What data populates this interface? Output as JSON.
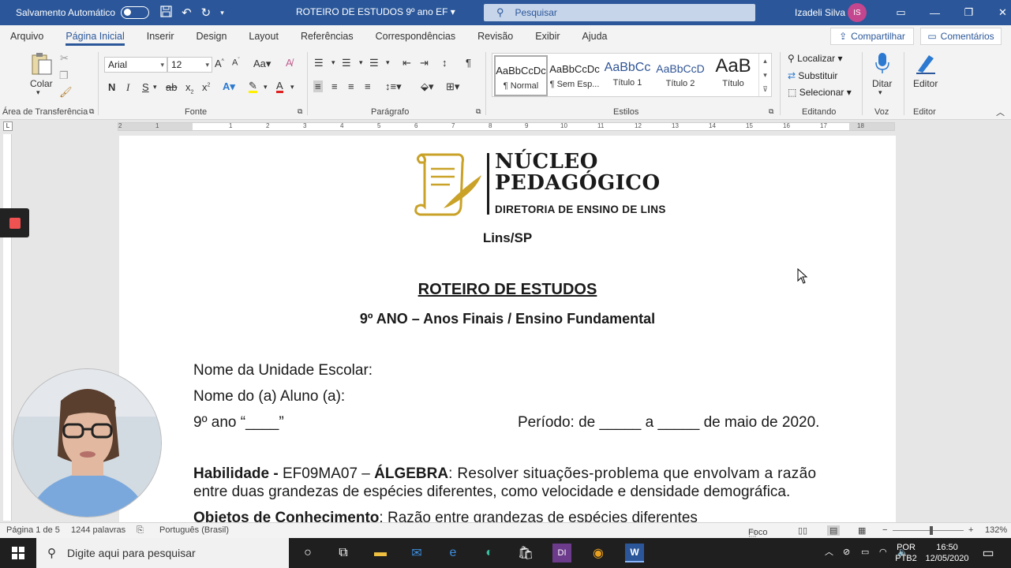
{
  "titlebar": {
    "autosave_label": "Salvamento Automático",
    "doc_title": "ROTEIRO DE ESTUDOS 9º ano EF",
    "search_placeholder": "Pesquisar",
    "user_name": "Izadeli Silva",
    "user_initials": "IS"
  },
  "tabs": [
    "Arquivo",
    "Página Inicial",
    "Inserir",
    "Design",
    "Layout",
    "Referências",
    "Correspondências",
    "Revisão",
    "Exibir",
    "Ajuda"
  ],
  "active_tab": "Página Inicial",
  "share_label": "Compartilhar",
  "comments_label": "Comentários",
  "ribbon": {
    "paste_label": "Colar",
    "font_name": "Arial",
    "font_size": "12",
    "styles": [
      {
        "preview": "AaBbCcDc",
        "name": "¶ Normal"
      },
      {
        "preview": "AaBbCcDc",
        "name": "¶ Sem Esp..."
      },
      {
        "preview": "AaBbCc",
        "name": "Título 1"
      },
      {
        "preview": "AaBbCcD",
        "name": "Título 2"
      },
      {
        "preview": "AaB",
        "name": "Título"
      }
    ],
    "find_label": "Localizar",
    "replace_label": "Substituir",
    "select_label": "Selecionar",
    "dictate_label": "Ditar",
    "editor_label": "Editor",
    "groups": [
      "Área de Transferência",
      "Fonte",
      "Parágrafo",
      "Estilos",
      "Editando",
      "Voz",
      "Editor"
    ]
  },
  "document": {
    "logo_line1": "NÚCLEO",
    "logo_line2": "PEDAGÓGICO",
    "logo_line3": "DIRETORIA DE ENSINO DE LINS",
    "city": "Lins/SP",
    "title": "ROTEIRO DE ESTUDOS",
    "subtitle": "9º ANO – Anos Finais / Ensino Fundamental",
    "school_label": "Nome da Unidade Escolar:",
    "student_label": "Nome do (a) Aluno (a):",
    "grade_label": "9º ano “____”",
    "period_label": "Período: de _____ a _____ de maio de 2020.",
    "skill_label": "Habilidade -",
    "skill_code": " EF09MA07 – ",
    "skill_area": "ÁLGEBRA",
    "skill_text_1": ": Resolver situações-problema que envolvam a razão",
    "skill_text_2": "entre duas grandezas de espécies diferentes, como velocidade e densidade demográfica.",
    "objects_label": "Objetos de Conhecimento",
    "objects_text": ": Razão entre grandezas de espécies diferentes"
  },
  "statusbar": {
    "page": "Página 1 de 5",
    "words": "1244 palavras",
    "language": "Português (Brasil)",
    "focus": "Foco",
    "zoom": "132%"
  },
  "taskbar": {
    "search_placeholder": "Digite aqui para pesquisar",
    "lang1": "POR",
    "lang2": "PTB2",
    "time": "16:50",
    "date": "12/05/2020"
  }
}
